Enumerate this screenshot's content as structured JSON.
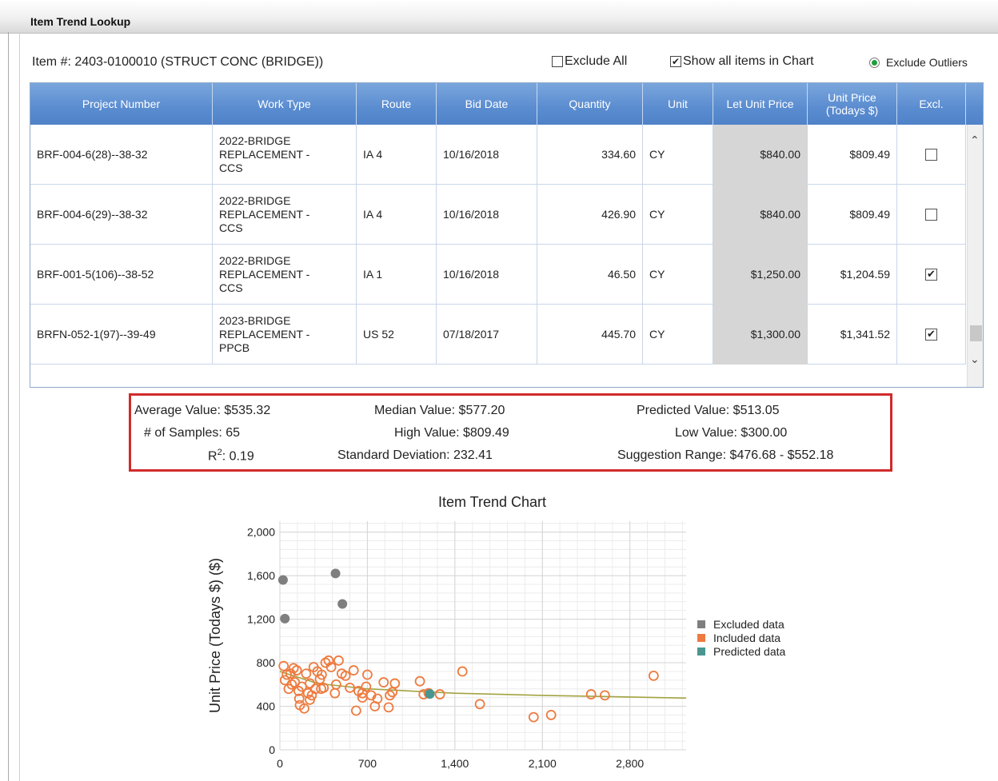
{
  "window": {
    "title": "Item Trend Lookup"
  },
  "item": {
    "label": "Item #: 2403-0100010 (STRUCT CONC (BRIDGE))"
  },
  "options": {
    "exclude_all_label": "Exclude All",
    "exclude_all_checked": false,
    "show_all_label": "Show all items in Chart",
    "show_all_checked": true,
    "exclude_outliers_label": "Exclude Outliers",
    "exclude_outliers_selected": true
  },
  "table": {
    "headers": {
      "project_number": "Project Number",
      "work_type": "Work Type",
      "route": "Route",
      "bid_date": "Bid Date",
      "quantity": "Quantity",
      "unit": "Unit",
      "let_unit_price": "Let Unit Price",
      "unit_price_today_1": "Unit Price",
      "unit_price_today_2": "(Todays $)",
      "excl": "Excl."
    },
    "rows": [
      {
        "project": "BRF-004-6(28)--38-32",
        "wt1": "2022-BRIDGE",
        "wt2": "REPLACEMENT -",
        "wt3": "CCS",
        "route": "IA 4",
        "bid_date": "10/16/2018",
        "quantity": "334.60",
        "unit": "CY",
        "let_price": "$840.00",
        "today_price": "$809.49",
        "excl": ""
      },
      {
        "project": "BRF-004-6(29)--38-32",
        "wt1": "2022-BRIDGE",
        "wt2": "REPLACEMENT -",
        "wt3": "CCS",
        "route": "IA 4",
        "bid_date": "10/16/2018",
        "quantity": "426.90",
        "unit": "CY",
        "let_price": "$840.00",
        "today_price": "$809.49",
        "excl": ""
      },
      {
        "project": "BRF-001-5(106)--38-52",
        "wt1": "2022-BRIDGE",
        "wt2": "REPLACEMENT -",
        "wt3": "CCS",
        "route": "IA 1",
        "bid_date": "10/16/2018",
        "quantity": "46.50",
        "unit": "CY",
        "let_price": "$1,250.00",
        "today_price": "$1,204.59",
        "excl": "✔"
      },
      {
        "project": "BRFN-052-1(97)--39-49",
        "wt1": "2023-BRIDGE",
        "wt2": "REPLACEMENT -",
        "wt3": "PPCB",
        "route": "US 52",
        "bid_date": "07/18/2017",
        "quantity": "445.70",
        "unit": "CY",
        "let_price": "$1,300.00",
        "today_price": "$1,341.52",
        "excl": "✔"
      }
    ]
  },
  "stats": {
    "average": "Average Value: $535.32",
    "median": "Median Value: $577.20",
    "predicted": "Predicted Value: $513.05",
    "samples": "# of Samples: 65",
    "high": "High Value: $809.49",
    "low": "Low Value: $300.00",
    "r2_prefix": "R",
    "r2_sup": "2",
    "r2_value": ": 0.19",
    "std_dev": "Standard Deviation: 232.41",
    "suggestion": "Suggestion Range: $476.68 - $552.18"
  },
  "chart_data": {
    "type": "scatter",
    "title": "Item Trend Chart",
    "ylabel": "Unit Price (Todays $) ($)",
    "xlabel": "",
    "xlim": [
      0,
      3250
    ],
    "ylim": [
      0,
      2100
    ],
    "x_ticks": [
      "0",
      "700",
      "1,400",
      "2,100",
      "2,800"
    ],
    "x_tick_values": [
      0,
      700,
      1400,
      2100,
      2800
    ],
    "y_ticks": [
      "0",
      "400",
      "800",
      "1,200",
      "1,600",
      "2,000"
    ],
    "y_tick_values": [
      0,
      400,
      800,
      1200,
      1600,
      2000
    ],
    "grid": true,
    "legend_position": "right",
    "colors": {
      "excluded": "#7f7f7f",
      "included": "#ee7b3f",
      "predicted": "#4a9690",
      "trend": "#a3a341"
    },
    "series": [
      {
        "name": "Excluded data",
        "points": [
          [
            25,
            1560
          ],
          [
            40,
            1205
          ],
          [
            445,
            1620
          ],
          [
            500,
            1340
          ]
        ]
      },
      {
        "name": "Included data",
        "points": [
          [
            30,
            770
          ],
          [
            40,
            640
          ],
          [
            55,
            690
          ],
          [
            70,
            560
          ],
          [
            85,
            700
          ],
          [
            95,
            600
          ],
          [
            110,
            750
          ],
          [
            120,
            620
          ],
          [
            135,
            730
          ],
          [
            150,
            540
          ],
          [
            160,
            410
          ],
          [
            175,
            580
          ],
          [
            195,
            380
          ],
          [
            210,
            700
          ],
          [
            225,
            520
          ],
          [
            240,
            610
          ],
          [
            255,
            500
          ],
          [
            270,
            760
          ],
          [
            285,
            560
          ],
          [
            300,
            720
          ],
          [
            320,
            650
          ],
          [
            335,
            690
          ],
          [
            350,
            570
          ],
          [
            365,
            800
          ],
          [
            390,
            820
          ],
          [
            410,
            760
          ],
          [
            440,
            520
          ],
          [
            470,
            820
          ],
          [
            495,
            700
          ],
          [
            525,
            680
          ],
          [
            560,
            570
          ],
          [
            590,
            730
          ],
          [
            610,
            360
          ],
          [
            630,
            540
          ],
          [
            660,
            520
          ],
          [
            690,
            580
          ],
          [
            700,
            690
          ],
          [
            730,
            500
          ],
          [
            760,
            400
          ],
          [
            780,
            470
          ],
          [
            830,
            620
          ],
          [
            870,
            390
          ],
          [
            900,
            530
          ],
          [
            920,
            610
          ],
          [
            1120,
            630
          ],
          [
            1150,
            510
          ],
          [
            1280,
            510
          ],
          [
            1460,
            720
          ],
          [
            1600,
            420
          ],
          [
            2030,
            300
          ],
          [
            2170,
            320
          ],
          [
            2490,
            510
          ],
          [
            2600,
            500
          ],
          [
            2990,
            680
          ],
          [
            330,
            560
          ],
          [
            240,
            460
          ],
          [
            660,
            480
          ],
          [
            880,
            500
          ],
          [
            1190,
            520
          ],
          [
            155,
            470
          ],
          [
            450,
            600
          ]
        ]
      },
      {
        "name": "Predicted data",
        "points": [
          [
            1200,
            513
          ]
        ]
      }
    ],
    "trendline": [
      [
        0,
        720
      ],
      [
        300,
        610
      ],
      [
        700,
        560
      ],
      [
        1400,
        520
      ],
      [
        2100,
        500
      ],
      [
        2800,
        485
      ],
      [
        3250,
        475
      ]
    ]
  }
}
